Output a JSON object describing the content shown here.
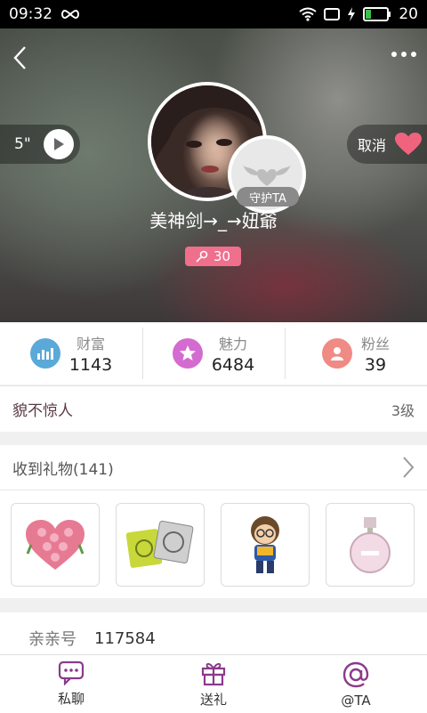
{
  "status_bar": {
    "time": "09:32",
    "battery": "20"
  },
  "profile": {
    "voice_duration": "5\"",
    "follow_cancel_label": "取消",
    "guard_label": "守护TA",
    "nickname": "美神剑→_→妞爺",
    "id_badge_value": "30"
  },
  "stats": [
    {
      "label": "财富",
      "value": "1143",
      "icon": "bar-chart-icon",
      "color": "#5aa9d8"
    },
    {
      "label": "魅力",
      "value": "6484",
      "icon": "star-icon",
      "color": "#d46bd0"
    },
    {
      "label": "粉丝",
      "value": "39",
      "icon": "fans-icon",
      "color": "#f08a84"
    }
  ],
  "level": {
    "title": "貌不惊人",
    "value": "3级"
  },
  "gifts": {
    "header": "收到礼物(141)",
    "items": [
      {
        "icon": "rose-heart-icon"
      },
      {
        "icon": "condom-pack-icon"
      },
      {
        "icon": "cartoon-boy-icon"
      },
      {
        "icon": "perfume-icon"
      }
    ]
  },
  "info": {
    "key": "亲亲号",
    "value": "117584"
  },
  "tabs": [
    {
      "label": "私聊",
      "icon": "chat-icon"
    },
    {
      "label": "送礼",
      "icon": "gift-icon"
    },
    {
      "label": "@TA",
      "icon": "at-icon"
    }
  ],
  "colors": {
    "accent": "#8b3a8b",
    "heart": "#f0637e",
    "badge": "#ef6f8d"
  }
}
